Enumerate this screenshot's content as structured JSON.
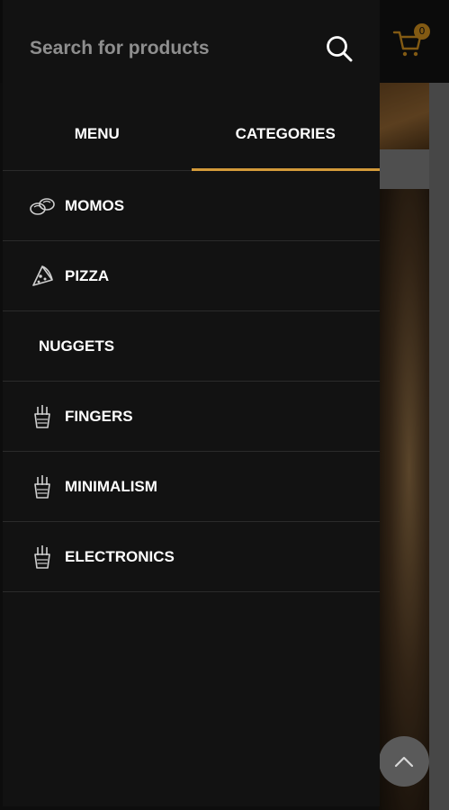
{
  "header": {
    "cart_count": "0"
  },
  "search": {
    "placeholder": "Search for products",
    "value": ""
  },
  "tabs": [
    {
      "label": "MENU",
      "active": false
    },
    {
      "label": "CATEGORIES",
      "active": true
    }
  ],
  "categories": [
    {
      "label": "MOMOS",
      "icon": "momos-icon"
    },
    {
      "label": "PIZZA",
      "icon": "pizza-icon"
    },
    {
      "label": "NUGGETS",
      "icon": ""
    },
    {
      "label": "FINGERS",
      "icon": "fries-icon"
    },
    {
      "label": "MINIMALISM",
      "icon": "fries-icon"
    },
    {
      "label": "ELECTRONICS",
      "icon": "fries-icon"
    }
  ],
  "colors": {
    "drawer_bg": "#121212",
    "accent": "#d39a3a",
    "badge": "#c88a1e",
    "text": "#ffffff",
    "placeholder": "#8e8e8e",
    "divider": "#2b2b2b"
  }
}
